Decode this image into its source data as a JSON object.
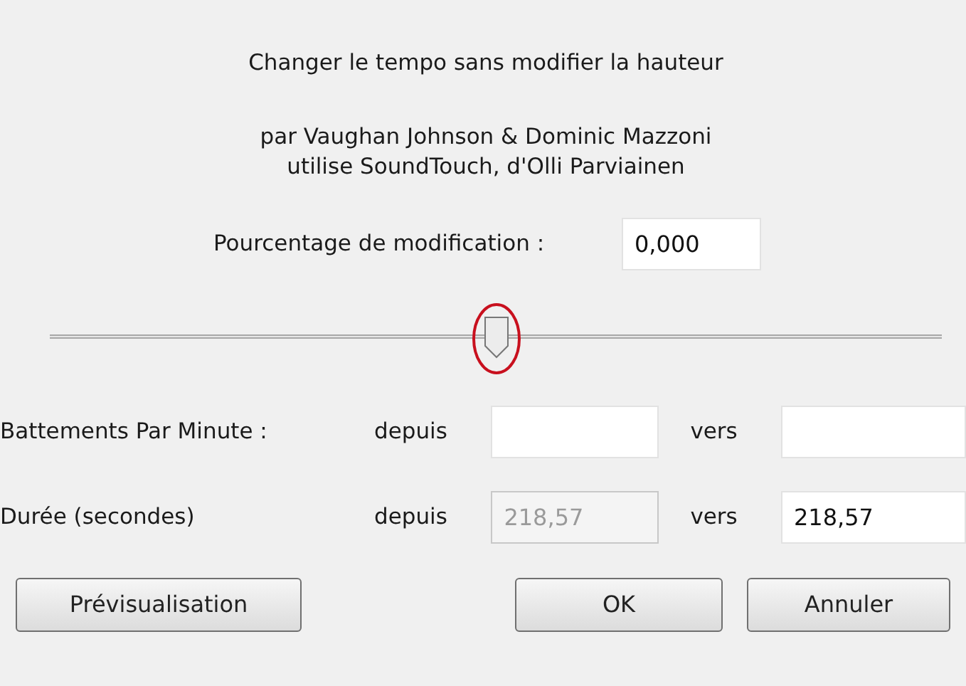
{
  "title": "Changer le tempo sans modifier la hauteur",
  "credits": [
    "par Vaughan Johnson & Dominic Mazzoni",
    "utilise SoundTouch, d'Olli Parviainen"
  ],
  "percent": {
    "label": "Pourcentage de modification :",
    "value": "0,000",
    "disabled": false
  },
  "slider": {
    "level": 0.5
  },
  "rows": [
    {
      "label": "Battements Par Minute :",
      "from_label": "depuis",
      "from": {
        "disabled": false
      },
      "to_label": "vers",
      "to": {
        "disabled": false
      }
    },
    {
      "label": "Durée (secondes)",
      "from_label": "depuis",
      "from": {
        "value": "218,57",
        "disabled": true
      },
      "to_label": "vers",
      "to": {
        "value": "218,57",
        "disabled": false
      }
    }
  ],
  "buttons": {
    "preview": "Prévisualisation",
    "ok": "OK",
    "cancel": "Annuler"
  }
}
